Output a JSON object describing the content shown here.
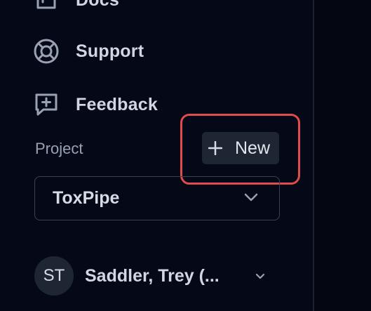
{
  "sidebar": {
    "nav": {
      "docs": {
        "label": "Docs",
        "icon": "book-icon"
      },
      "support": {
        "label": "Support",
        "icon": "lifebuoy-icon"
      },
      "feedback": {
        "label": "Feedback",
        "icon": "message-plus-icon"
      }
    },
    "project": {
      "label": "Project",
      "new_button_label": "New",
      "new_button_icon": "plus-icon",
      "selected": "ToxPipe",
      "chevron_icon": "chevron-down-icon"
    },
    "user": {
      "initials": "ST",
      "name": "Saddler, Trey (...",
      "chevron_icon": "chevron-down-icon"
    }
  },
  "colors": {
    "background": "#050816",
    "highlight": "#e04b4b",
    "button_bg": "#1f2633",
    "text": "#d6dbe6",
    "muted": "#98a2b3"
  }
}
